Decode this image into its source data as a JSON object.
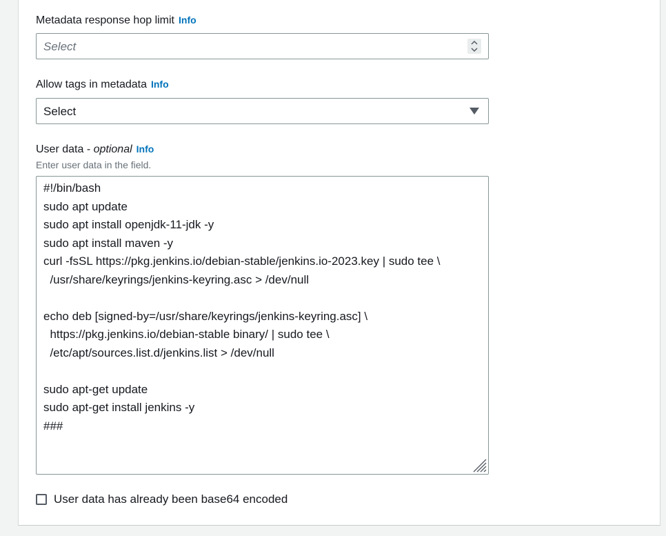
{
  "hop_limit": {
    "label": "Metadata response hop limit",
    "info": "Info",
    "placeholder": "Select"
  },
  "allow_tags": {
    "label": "Allow tags in metadata",
    "info": "Info",
    "value": "Select"
  },
  "user_data": {
    "label": "User data - ",
    "label_optional": "optional",
    "info": "Info",
    "description": "Enter user data in the field.",
    "value": "#!/bin/bash\nsudo apt update\nsudo apt install openjdk-11-jdk -y\nsudo apt install maven -y\ncurl -fsSL https://pkg.jenkins.io/debian-stable/jenkins.io-2023.key | sudo tee \\\n  /usr/share/keyrings/jenkins-keyring.asc > /dev/null\n\necho deb [signed-by=/usr/share/keyrings/jenkins-keyring.asc] \\\n  https://pkg.jenkins.io/debian-stable binary/ | sudo tee \\\n  /etc/apt/sources.list.d/jenkins.list > /dev/null\n\nsudo apt-get update\nsudo apt-get install jenkins -y\n###"
  },
  "base64_checkbox": {
    "label": "User data has already been base64 encoded",
    "checked": false
  },
  "colors": {
    "info_link": "#0073bb",
    "border": "#879596",
    "text": "#16191f",
    "secondary_text": "#687078"
  }
}
